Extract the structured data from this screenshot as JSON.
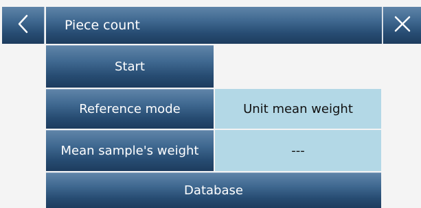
{
  "header": {
    "title": "Piece count",
    "back_icon": "chevron-left-icon",
    "close_icon": "close-icon"
  },
  "menu": {
    "start_label": "Start",
    "reference_mode": {
      "label": "Reference mode",
      "value": "Unit mean weight"
    },
    "mean_sample_weight": {
      "label": "Mean sample's weight",
      "value": "---"
    },
    "database_label": "Database"
  },
  "colors": {
    "header_blue": "#3f6890",
    "value_bg": "#b3d8e6",
    "screen_bg": "#f4f4f4"
  }
}
